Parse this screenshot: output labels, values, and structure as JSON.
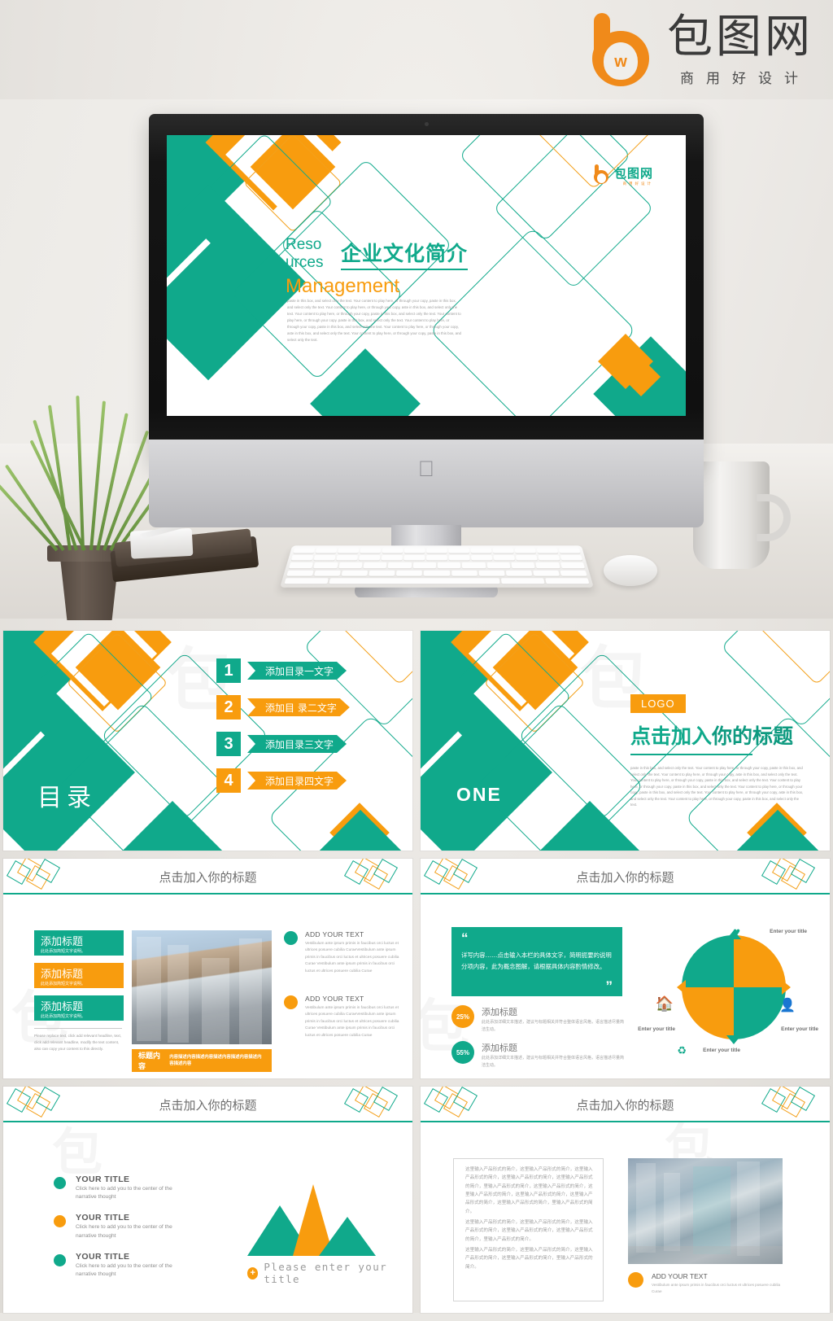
{
  "brand": {
    "name_cn": "包图网",
    "tagline_cn": "商用好设计",
    "mark_letter": "b",
    "mark_glyph": "w"
  },
  "cover_slide": {
    "eyebrow_line1": "Reso",
    "eyebrow_line2": "urces",
    "title_cn": "企业文化简介",
    "subtitle_en": "Management",
    "body": "paste in this box, and select only the text. Your content to play here, or through your copy, paste in this box, and select only the text. Your content to play here, or through your copy, aste in this box, and select only the text. Your content to play here, or through your copy, paste in this box, and select only the text. Your content to play here, or through your copy. paste in this box, and select only the text. Your content to play here, or through your copy, paste in this box, and select only the text. Your content to play here, or through your copy, aste in this box, and select only the text. Your content to play here, or through your copy, paste in this box, and select only the text.",
    "logo_cn": "包图网",
    "logo_sub": "商用好设计"
  },
  "toc_slide": {
    "label": "目录",
    "items": [
      {
        "num": "1",
        "text": "添加目录一文字",
        "color": "teal"
      },
      {
        "num": "2",
        "text": "添加目 录二文字",
        "color": "orange"
      },
      {
        "num": "3",
        "text": "添加目录三文字",
        "color": "teal"
      },
      {
        "num": "4",
        "text": "添加目录四文字",
        "color": "orange"
      }
    ]
  },
  "section_slide": {
    "label": "ONE",
    "logo_label": "LOGO",
    "title_a": "点击加入",
    "title_b": "你的标题",
    "body": "paste in this box, and select only the text. Your content to play here, or through your copy, paste in this box, and select only the text. Your content to play here, or through your copy, aste in this box, and select only the text. Your content to play here, or through your copy, paste in this box, and select only the text. Your content to play here, or through your copy. paste in this box, and select only the text. Your content to play here, or through your copy, paste in this box, and select only the text. Your content to play here, or through your copy, aste in this box, and select only the text. Your content to play here, or through your copy, paste in this box, and select only the text."
  },
  "content_slides": {
    "common_title": "点击加入你的标题"
  },
  "slide_cards": {
    "cards": [
      {
        "title": "添加标题",
        "sub": "此处添加简短文字说明。",
        "color": "teal"
      },
      {
        "title": "添加标题",
        "sub": "此处添加简短文字说明。",
        "color": "orange"
      },
      {
        "title": "添加标题",
        "sub": "此处添加简短文字说明。",
        "color": "teal"
      }
    ],
    "note": "Please replace text, click add relevant headline, text, click add relevant headline, modify the text content, also can copy your content to this directly.",
    "bar_title": "标题内容",
    "bar_body": "内容描述内容描述内容描述内容描述内容描述内容描述内容",
    "blocks": [
      {
        "title": "ADD YOUR TEXT",
        "body": "Vestibulum ante ipsum primis in faucibus orci luctus et ultrices posuere cubilia CuraeVestibulum ante ipsum primis in faucibus orci luctus et ultrices posuere cubilia Curae Vestibulum ante ipsum primis in faucibus orci luctus et ultrices posuere cubilia Curae",
        "color": "teal"
      },
      {
        "title": "ADD YOUR TEXT",
        "body": "Vestibulum ante ipsum primis in faucibus orci luctus et ultrices posuere cubilia CuraeVestibulum ante ipsum primis in faucibus orci luctus et ultrices posuere cubilia Curae Vestibulum ante ipsum primis in faucibus orci luctus et ultrices posuere cubilia Curae",
        "color": "orange"
      }
    ]
  },
  "slide_quote": {
    "quote_open": "“",
    "quote_close": "”",
    "quote_text": "详写内容……点击输入本栏的具体文字，简明扼要的说明分项内容，此为概念图解，请根据具体内容酌情修改。",
    "stats": [
      {
        "pct": "25%",
        "title": "添加标题",
        "body": "此处添加详细文本描述，建议与标题相关并符合整体语言风格，语言描述尽量简洁生动。",
        "color": "orange"
      },
      {
        "pct": "55%",
        "title": "添加标题",
        "body": "此处添加详细文本描述，建议与标题相关并符合整体语言风格，语言描述尽量简洁生动。",
        "color": "teal"
      }
    ],
    "pie_labels": [
      {
        "text": "Enter your title",
        "icon": "heart-icon",
        "position": "top"
      },
      {
        "text": "Enter your title",
        "icon": "person-icon",
        "position": "right"
      },
      {
        "text": "Enter your title",
        "icon": "recycle-icon",
        "position": "bottom"
      },
      {
        "text": "Enter your title",
        "icon": "home-icon",
        "position": "left"
      }
    ]
  },
  "slide_bullets": {
    "items": [
      {
        "title": "YOUR  TITLE",
        "body": "Click here to add  you to the center of the narrative thought",
        "color": "teal"
      },
      {
        "title": "YOUR  TITLE",
        "body": "Click here to add  you to the center of the narrative thought",
        "color": "orange"
      },
      {
        "title": "YOUR  TITLE",
        "body": "Click here to add  you to the center of the narrative thought",
        "color": "teal"
      }
    ],
    "caption": "Please enter your title",
    "plus": "+"
  },
  "slide_text": {
    "paragraphs": [
      "这里输入产品形式的简介，这里输入产品形式的简介，这里输入产品形式的简介，这里输入产品形式的简介，这里输入产品形式的简介，里输入产品形式的简介，这里输入产品形式的简介，这里输入产品形式的简介，这里输入产品形式的简介，这里输入产品形式的简介，这里输入产品形式的简介，里输入产品形式的简介。",
      "这里输入产品形式的简介，这里输入产品形式的简介，这里输入产品形式的简介，这里输入产品形式的简介，这里输入产品形式的简介，里输入产品形式的简介。",
      "这里输入产品形式的简介，这里输入产品形式的简介，这里输入产品形式的简介，这里输入产品形式的简介，里输入产品形式的简介。"
    ],
    "add_title": "ADD YOUR TEXT",
    "add_body": "Vestibulum ante ipsum primis in faucibus orci luctus et ultrices posuere cubilia Curae"
  },
  "colors": {
    "teal": "#10a98b",
    "orange": "#f89c0e",
    "brand_orange": "#f08a1a",
    "page_bg": "#e9e7e3",
    "text_gray": "#6d6d6d"
  }
}
